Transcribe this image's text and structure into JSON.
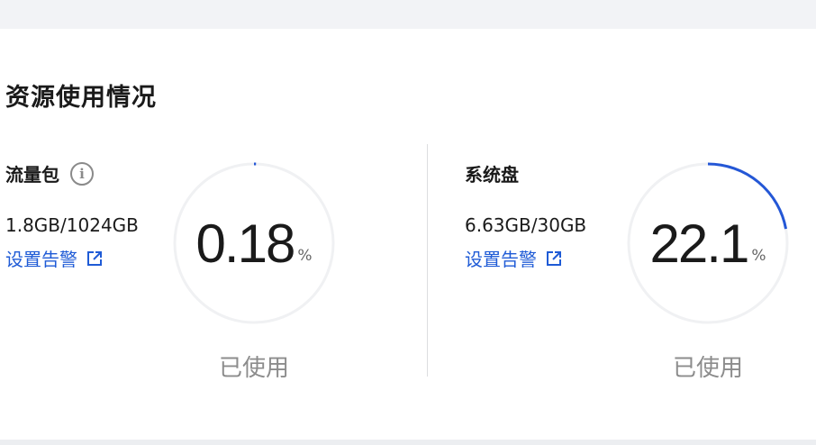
{
  "section": {
    "title": "资源使用情况"
  },
  "metrics": [
    {
      "name": "流量包",
      "info_icon": "info-icon",
      "usage": "1.8GB/1024GB",
      "alert_link": "设置告警",
      "percent_value": "0.18",
      "percent_unit": "%",
      "fraction": 0.0018,
      "used_label": "已使用"
    },
    {
      "name": "系统盘",
      "usage": "6.63GB/30GB",
      "alert_link": "设置告警",
      "percent_value": "22.1",
      "percent_unit": "%",
      "fraction": 0.221,
      "used_label": "已使用"
    }
  ],
  "colors": {
    "accent": "#1f5bd6",
    "track": "#f0f1f3",
    "progress": "#2457d6"
  }
}
